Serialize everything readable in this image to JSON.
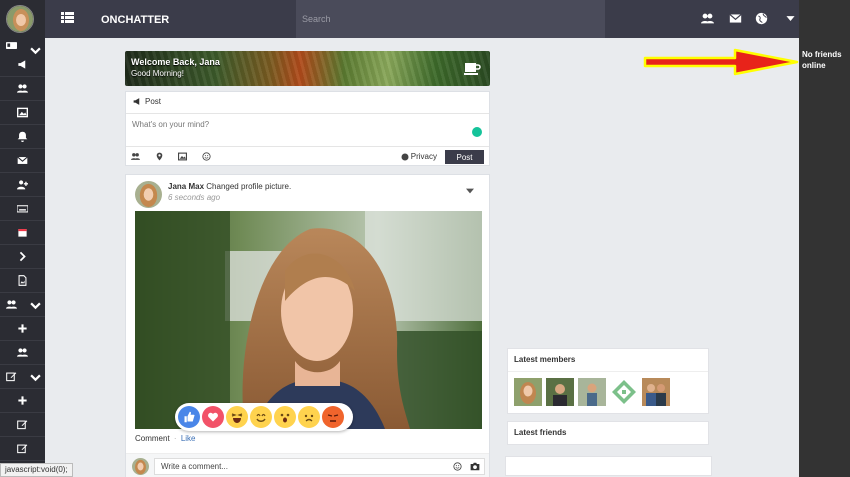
{
  "app": {
    "brand": "ONCHATTER"
  },
  "search": {
    "placeholder": "Search"
  },
  "welcome": {
    "title": "Welcome Back, Jana",
    "subtitle": "Good Morning!"
  },
  "composer": {
    "tab_label": "Post",
    "placeholder": "What's on your mind?",
    "privacy_label": "Privacy",
    "post_button": "Post"
  },
  "post": {
    "author": "Jana Max",
    "action": "Changed profile picture.",
    "time": "6 seconds ago",
    "comment_label": "Comment",
    "like_label": "Like",
    "separator": "·",
    "reactions": [
      "like",
      "love",
      "haha",
      "yay",
      "wow",
      "sad",
      "angry"
    ]
  },
  "write_comment": {
    "placeholder": "Write a comment..."
  },
  "widgets": {
    "latest_members": "Latest members",
    "latest_friends": "Latest friends"
  },
  "right_panel": {
    "no_friends": "No friends online"
  },
  "status_bar": {
    "text": "javascript:void(0);"
  },
  "colors": {
    "topbar": "#3b3c4a",
    "sidebar": "#2b2c33",
    "page_bg": "#e9ebee",
    "arrow": "#e8231a",
    "arrow_outline": "#ffff00"
  }
}
